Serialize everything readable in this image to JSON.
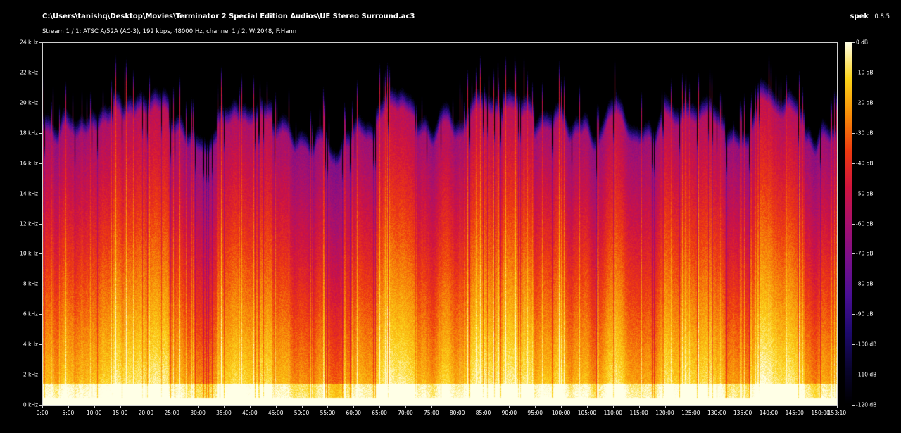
{
  "header": {
    "file_path": "C:\\Users\\tanishq\\Desktop\\Movies\\Terminator 2 Special Edition Audios\\UE Stereo Surround.ac3",
    "stream_info": "Stream 1 / 1: ATSC A/52A (AC-3), 192 kbps, 48000 Hz, channel 1 / 2, W:2048, F:Hann",
    "app_name": "spek",
    "app_version": "0.8.5"
  },
  "spectrogram": {
    "x_unit": "minutes",
    "x_range": [
      0,
      153.17
    ],
    "y_unit": "kHz",
    "y_range": [
      0,
      24
    ],
    "db_range": [
      -120,
      0
    ],
    "y_ticks": [
      "0 kHz",
      "2 kHz",
      "4 kHz",
      "6 kHz",
      "8 kHz",
      "10 kHz",
      "12 kHz",
      "14 kHz",
      "16 kHz",
      "18 kHz",
      "20 kHz",
      "22 kHz",
      "24 kHz"
    ],
    "x_ticks": [
      "0:00",
      "5:00",
      "10:00",
      "15:00",
      "20:00",
      "25:00",
      "30:00",
      "35:00",
      "40:00",
      "45:00",
      "50:00",
      "55:00",
      "60:00",
      "65:00",
      "70:00",
      "75:00",
      "80:00",
      "85:00",
      "90:00",
      "95:00",
      "100:00",
      "105:00",
      "110:00",
      "115:00",
      "120:00",
      "125:00",
      "130:00",
      "135:00",
      "140:00",
      "145:00",
      "150:00",
      "153:10"
    ],
    "color_scale_ticks": [
      "0 dB",
      "-10 dB",
      "-20 dB",
      "-30 dB",
      "-40 dB",
      "-50 dB",
      "-60 dB",
      "-70 dB",
      "-80 dB",
      "-90 dB",
      "-100 dB",
      "-110 dB",
      "-120 dB"
    ],
    "colormap": [
      "#000000",
      "#0a0530",
      "#1e0a6e",
      "#4a0f96",
      "#7a0f8c",
      "#a8106e",
      "#d1143f",
      "#ee3a10",
      "#f88d08",
      "#fcd41a",
      "#ffffe6"
    ]
  }
}
